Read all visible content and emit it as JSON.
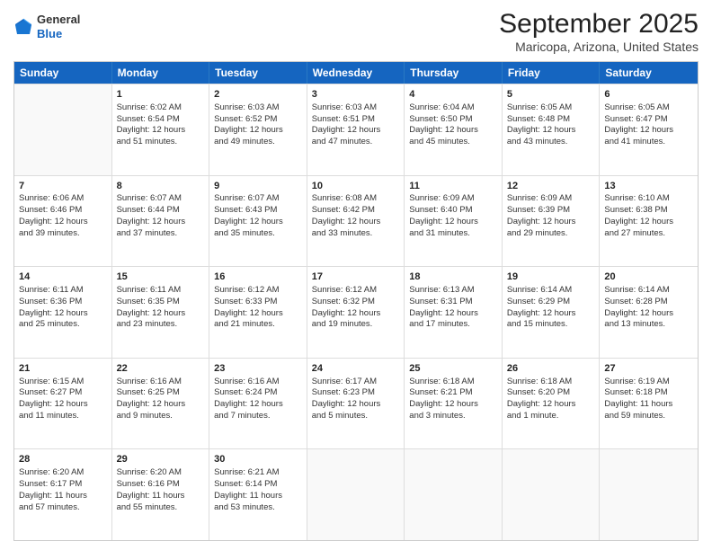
{
  "logo": {
    "general": "General",
    "blue": "Blue"
  },
  "title": "September 2025",
  "subtitle": "Maricopa, Arizona, United States",
  "days_of_week": [
    "Sunday",
    "Monday",
    "Tuesday",
    "Wednesday",
    "Thursday",
    "Friday",
    "Saturday"
  ],
  "weeks": [
    [
      {
        "day": "",
        "info": ""
      },
      {
        "day": "1",
        "info": "Sunrise: 6:02 AM\nSunset: 6:54 PM\nDaylight: 12 hours\nand 51 minutes."
      },
      {
        "day": "2",
        "info": "Sunrise: 6:03 AM\nSunset: 6:52 PM\nDaylight: 12 hours\nand 49 minutes."
      },
      {
        "day": "3",
        "info": "Sunrise: 6:03 AM\nSunset: 6:51 PM\nDaylight: 12 hours\nand 47 minutes."
      },
      {
        "day": "4",
        "info": "Sunrise: 6:04 AM\nSunset: 6:50 PM\nDaylight: 12 hours\nand 45 minutes."
      },
      {
        "day": "5",
        "info": "Sunrise: 6:05 AM\nSunset: 6:48 PM\nDaylight: 12 hours\nand 43 minutes."
      },
      {
        "day": "6",
        "info": "Sunrise: 6:05 AM\nSunset: 6:47 PM\nDaylight: 12 hours\nand 41 minutes."
      }
    ],
    [
      {
        "day": "7",
        "info": "Sunrise: 6:06 AM\nSunset: 6:46 PM\nDaylight: 12 hours\nand 39 minutes."
      },
      {
        "day": "8",
        "info": "Sunrise: 6:07 AM\nSunset: 6:44 PM\nDaylight: 12 hours\nand 37 minutes."
      },
      {
        "day": "9",
        "info": "Sunrise: 6:07 AM\nSunset: 6:43 PM\nDaylight: 12 hours\nand 35 minutes."
      },
      {
        "day": "10",
        "info": "Sunrise: 6:08 AM\nSunset: 6:42 PM\nDaylight: 12 hours\nand 33 minutes."
      },
      {
        "day": "11",
        "info": "Sunrise: 6:09 AM\nSunset: 6:40 PM\nDaylight: 12 hours\nand 31 minutes."
      },
      {
        "day": "12",
        "info": "Sunrise: 6:09 AM\nSunset: 6:39 PM\nDaylight: 12 hours\nand 29 minutes."
      },
      {
        "day": "13",
        "info": "Sunrise: 6:10 AM\nSunset: 6:38 PM\nDaylight: 12 hours\nand 27 minutes."
      }
    ],
    [
      {
        "day": "14",
        "info": "Sunrise: 6:11 AM\nSunset: 6:36 PM\nDaylight: 12 hours\nand 25 minutes."
      },
      {
        "day": "15",
        "info": "Sunrise: 6:11 AM\nSunset: 6:35 PM\nDaylight: 12 hours\nand 23 minutes."
      },
      {
        "day": "16",
        "info": "Sunrise: 6:12 AM\nSunset: 6:33 PM\nDaylight: 12 hours\nand 21 minutes."
      },
      {
        "day": "17",
        "info": "Sunrise: 6:12 AM\nSunset: 6:32 PM\nDaylight: 12 hours\nand 19 minutes."
      },
      {
        "day": "18",
        "info": "Sunrise: 6:13 AM\nSunset: 6:31 PM\nDaylight: 12 hours\nand 17 minutes."
      },
      {
        "day": "19",
        "info": "Sunrise: 6:14 AM\nSunset: 6:29 PM\nDaylight: 12 hours\nand 15 minutes."
      },
      {
        "day": "20",
        "info": "Sunrise: 6:14 AM\nSunset: 6:28 PM\nDaylight: 12 hours\nand 13 minutes."
      }
    ],
    [
      {
        "day": "21",
        "info": "Sunrise: 6:15 AM\nSunset: 6:27 PM\nDaylight: 12 hours\nand 11 minutes."
      },
      {
        "day": "22",
        "info": "Sunrise: 6:16 AM\nSunset: 6:25 PM\nDaylight: 12 hours\nand 9 minutes."
      },
      {
        "day": "23",
        "info": "Sunrise: 6:16 AM\nSunset: 6:24 PM\nDaylight: 12 hours\nand 7 minutes."
      },
      {
        "day": "24",
        "info": "Sunrise: 6:17 AM\nSunset: 6:23 PM\nDaylight: 12 hours\nand 5 minutes."
      },
      {
        "day": "25",
        "info": "Sunrise: 6:18 AM\nSunset: 6:21 PM\nDaylight: 12 hours\nand 3 minutes."
      },
      {
        "day": "26",
        "info": "Sunrise: 6:18 AM\nSunset: 6:20 PM\nDaylight: 12 hours\nand 1 minute."
      },
      {
        "day": "27",
        "info": "Sunrise: 6:19 AM\nSunset: 6:18 PM\nDaylight: 11 hours\nand 59 minutes."
      }
    ],
    [
      {
        "day": "28",
        "info": "Sunrise: 6:20 AM\nSunset: 6:17 PM\nDaylight: 11 hours\nand 57 minutes."
      },
      {
        "day": "29",
        "info": "Sunrise: 6:20 AM\nSunset: 6:16 PM\nDaylight: 11 hours\nand 55 minutes."
      },
      {
        "day": "30",
        "info": "Sunrise: 6:21 AM\nSunset: 6:14 PM\nDaylight: 11 hours\nand 53 minutes."
      },
      {
        "day": "",
        "info": ""
      },
      {
        "day": "",
        "info": ""
      },
      {
        "day": "",
        "info": ""
      },
      {
        "day": "",
        "info": ""
      }
    ]
  ]
}
